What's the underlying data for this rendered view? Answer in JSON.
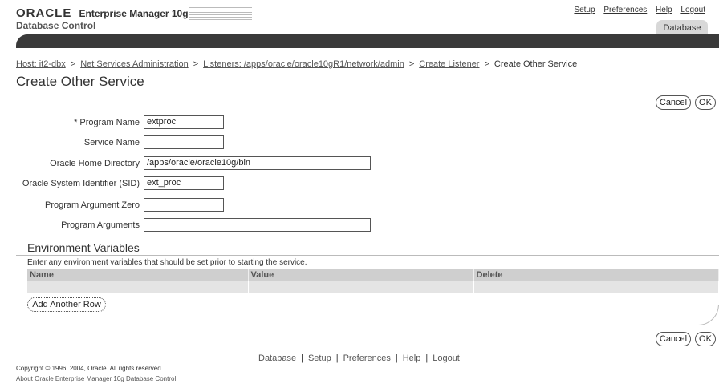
{
  "header": {
    "oracle": "ORACLE",
    "em_title": "Enterprise Manager 10g",
    "subtitle": "Database Control",
    "global_links": [
      "Setup",
      "Preferences",
      "Help",
      "Logout"
    ],
    "tab": "Database"
  },
  "breadcrumb": {
    "host": "Host: it2-dbx",
    "net_services": "Net Services Administration",
    "listeners": "Listeners: /apps/oracle/oracle10gR1/network/admin",
    "create_listener": "Create Listener",
    "current": "Create Other Service",
    "separator": ">"
  },
  "page": {
    "title": "Create Other Service",
    "cancel_label": "Cancel",
    "ok_label": "OK"
  },
  "form": {
    "required_marker": "*",
    "program_name": {
      "label": "Program Name",
      "value": "extproc"
    },
    "service_name": {
      "label": "Service Name",
      "value": ""
    },
    "oracle_home": {
      "label": "Oracle Home Directory",
      "value": "/apps/oracle/oracle10g/bin"
    },
    "sid": {
      "label": "Oracle System Identifier (SID)",
      "value": "ext_proc"
    },
    "arg_zero": {
      "label": "Program Argument Zero",
      "value": ""
    },
    "args": {
      "label": "Program Arguments",
      "value": ""
    }
  },
  "env": {
    "title": "Environment Variables",
    "instructions": "Enter any environment variables that should be set prior to starting the service.",
    "columns": [
      "Name",
      "Value",
      "Delete"
    ],
    "add_row_label": "Add Another Row"
  },
  "footer": {
    "links": [
      "Database",
      "Setup",
      "Preferences",
      "Help",
      "Logout"
    ],
    "copyright": "Copyright © 1996, 2004, Oracle. All rights reserved.",
    "about": "About Oracle Enterprise Manager 10g Database Control"
  }
}
